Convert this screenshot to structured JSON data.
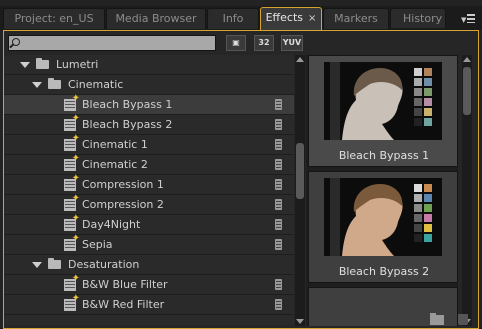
{
  "tabs": [
    {
      "label": "Project: en_US",
      "active": false
    },
    {
      "label": "Media Browser",
      "active": false
    },
    {
      "label": "Info",
      "active": false
    },
    {
      "label": "Effects",
      "active": true,
      "close_glyph": "×"
    },
    {
      "label": "Markers",
      "active": false
    },
    {
      "label": "History",
      "active": false
    }
  ],
  "toolbar": {
    "search_value": "",
    "search_placeholder": "",
    "filter_buttons": [
      "",
      "32",
      "YUV"
    ]
  },
  "tree": {
    "items": [
      {
        "label": "Lumetri",
        "type": "folder",
        "level": 1
      },
      {
        "label": "Cinematic",
        "type": "folder",
        "level": 2
      },
      {
        "label": "Bleach Bypass 1",
        "type": "effect",
        "selected": true
      },
      {
        "label": "Bleach Bypass 2",
        "type": "effect"
      },
      {
        "label": "Cinematic 1",
        "type": "effect"
      },
      {
        "label": "Cinematic 2",
        "type": "effect"
      },
      {
        "label": "Compression 1",
        "type": "effect"
      },
      {
        "label": "Compression 2",
        "type": "effect"
      },
      {
        "label": "Day4Night",
        "type": "effect"
      },
      {
        "label": "Sepia",
        "type": "effect"
      },
      {
        "label": "Desaturation",
        "type": "folder",
        "level": 2
      },
      {
        "label": "B&W Blue Filter",
        "type": "effect"
      },
      {
        "label": "B&W Red Filter",
        "type": "effect"
      }
    ]
  },
  "preview": {
    "cards": [
      {
        "caption": "Bleach Bypass 1",
        "selected": true
      },
      {
        "caption": "Bleach Bypass 2",
        "selected": false
      }
    ]
  },
  "colors": {
    "accent": "#d6a530",
    "panel_bg": "#262626",
    "star": "#e8c23a"
  }
}
